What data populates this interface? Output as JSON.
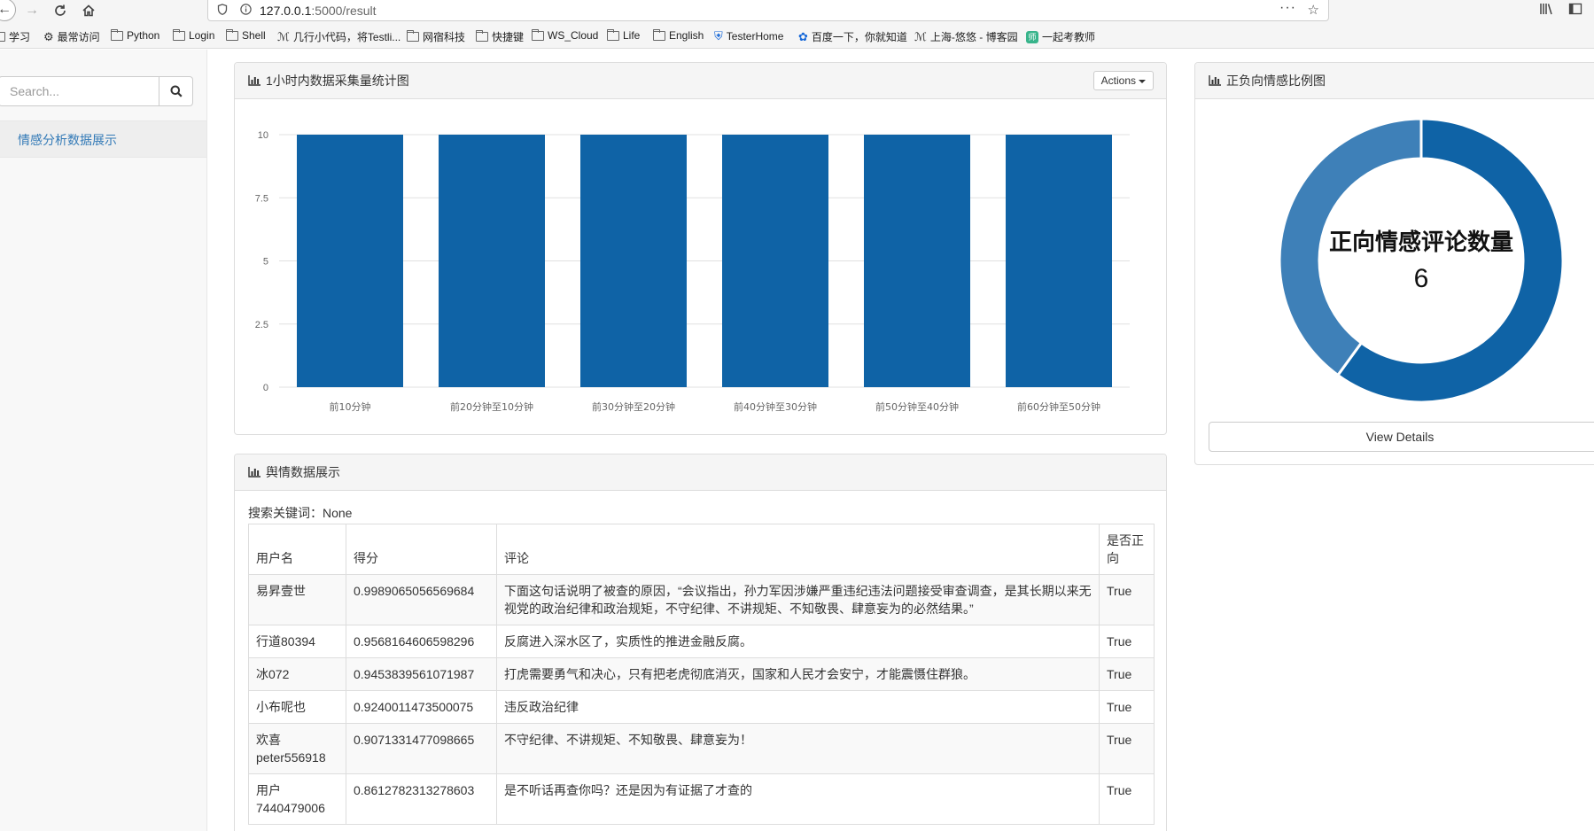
{
  "browser": {
    "url_host": "127.0.0.1",
    "url_path": ":5000/result",
    "bookmarks": [
      "学习",
      "最常访问",
      "Python",
      "Login",
      "Shell",
      "几行小代码，将Testli...",
      "网宿科技",
      "快捷键",
      "WS_Cloud",
      "Life",
      "English",
      "TesterHome",
      "百度一下，你就知道",
      "上海-悠悠 - 博客园",
      "一起考教师"
    ]
  },
  "sidebar": {
    "search_placeholder": "Search...",
    "nav_item": "情感分析数据展示"
  },
  "bar_panel": {
    "title": "1小时内数据采集量统计图",
    "actions_label": "Actions"
  },
  "donut_panel": {
    "title": "正负向情感比例图",
    "center_label": "正向情感评论数量",
    "center_value": "6",
    "view_details": "View Details"
  },
  "table_panel": {
    "title": "舆情数据展示",
    "keyword_line": "搜索关键词：None",
    "headers": [
      "用户名",
      "得分",
      "评论",
      "是否正向"
    ],
    "rows": [
      {
        "user": "易昇壹世",
        "score": "0.9989065056569684",
        "comment": "下面这句话说明了被查的原因，“会议指出，孙力军因涉嫌严重违纪违法问题接受审查调查，是其长期以来无视党的政治纪律和政治规矩，不守纪律、不讲规矩、不知敬畏、肆意妄为的必然结果。”",
        "positive": "True"
      },
      {
        "user": "行道80394",
        "score": "0.9568164606598296",
        "comment": "反腐进入深水区了，实质性的推进金融反腐。",
        "positive": "True"
      },
      {
        "user": "冰072",
        "score": "0.9453839561071987",
        "comment": "打虎需要勇气和决心，只有把老虎彻底消灭，国家和人民才会安宁，才能震慑住群狼。",
        "positive": "True"
      },
      {
        "user": "小布呢也",
        "score": "0.9240011473500075",
        "comment": "违反政治纪律",
        "positive": "True"
      },
      {
        "user": "欢喜peter556918",
        "score": "0.9071331477098665",
        "comment": "不守纪律、不讲规矩、不知敬畏、肆意妄为！",
        "positive": "True"
      },
      {
        "user": "用户7440479006",
        "score": "0.8612782313278603",
        "comment": "是不听话再查你吗？还是因为有证据了才查的",
        "positive": "True"
      }
    ]
  },
  "colors": {
    "bar": "#0f63a6",
    "donut_dark": "#0f63a6",
    "donut_light": "#3e80b8",
    "link": "#337ab7"
  },
  "chart_data": [
    {
      "type": "bar",
      "title": "1小时内数据采集量统计图",
      "categories": [
        "前10分钟",
        "前20分钟至10分钟",
        "前30分钟至20分钟",
        "前40分钟至30分钟",
        "前50分钟至40分钟",
        "前60分钟至50分钟"
      ],
      "values": [
        10,
        10,
        10,
        10,
        10,
        10
      ],
      "yticks": [
        "0",
        "2.5",
        "5",
        "7.5",
        "10"
      ],
      "ylim": [
        0,
        10
      ],
      "grid": true
    },
    {
      "type": "pie",
      "title": "正负向情感比例图",
      "center_label": "正向情感评论数量",
      "center_value": 6,
      "slices": [
        {
          "value": 6,
          "color": "#0f63a6"
        },
        {
          "value": 4,
          "color": "#3e80b8"
        }
      ]
    }
  ]
}
